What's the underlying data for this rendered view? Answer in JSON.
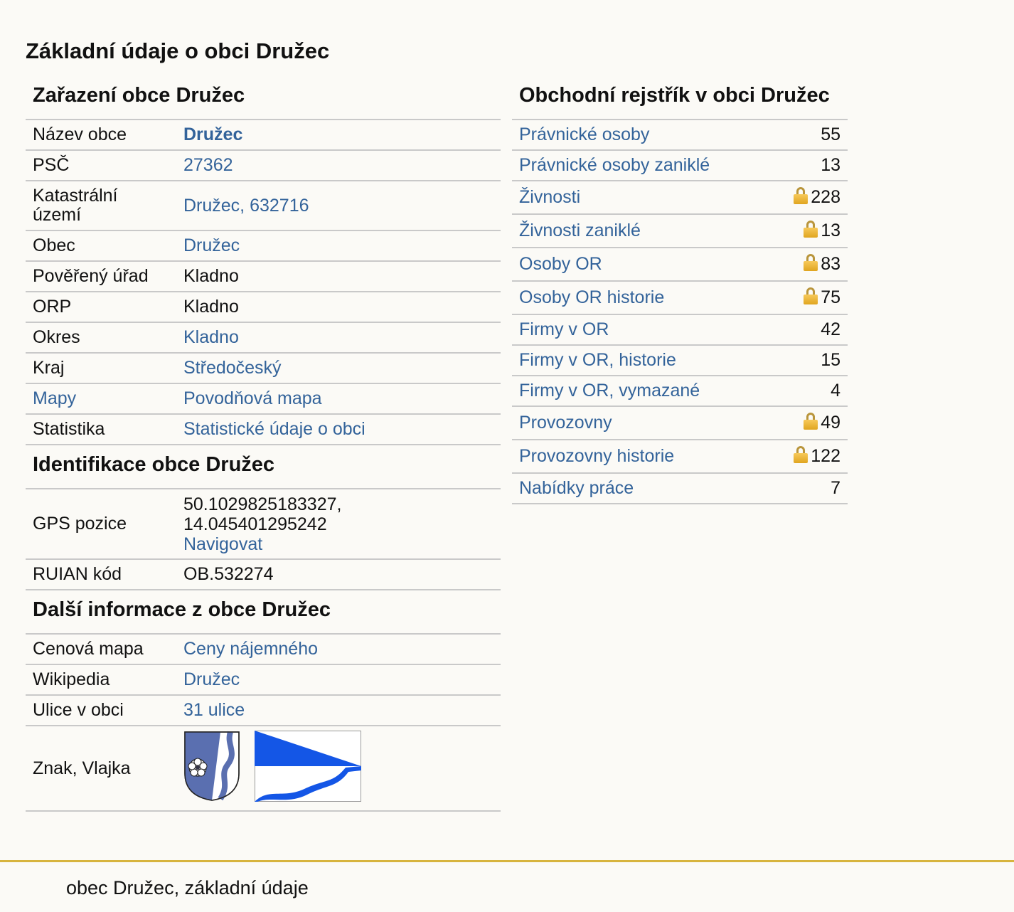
{
  "page": {
    "title": "Základní údaje o obci Družec"
  },
  "zarazeni": {
    "heading": "Zařazení obce Družec",
    "rows": [
      {
        "key": "Název obce",
        "value": "Družec"
      },
      {
        "key": "PSČ",
        "value": "27362"
      },
      {
        "key": "Katastrální území",
        "value": "Družec, 632716"
      },
      {
        "key": "Obec",
        "value": "Družec"
      },
      {
        "key": "Pověřený úřad",
        "value": "Kladno"
      },
      {
        "key": "ORP",
        "value": "Kladno"
      },
      {
        "key": "Okres",
        "value": "Kladno"
      },
      {
        "key": "Kraj",
        "value": "Středočeský"
      },
      {
        "key": "Mapy",
        "value": "Povodňová mapa"
      },
      {
        "key": "Statistika",
        "value": "Statistické údaje o obci"
      }
    ]
  },
  "identifikace": {
    "heading": "Identifikace obce Družec",
    "gps": {
      "key": "GPS pozice",
      "lat": "50.1029825183327,",
      "lon": "14.045401295242",
      "nav": "Navigovat"
    },
    "ruian": {
      "key": "RUIAN kód",
      "value": "OB.532274"
    }
  },
  "dalsi": {
    "heading": "Další informace z obce Družec",
    "rows": [
      {
        "key": "Cenová mapa",
        "value": "Ceny nájemného"
      },
      {
        "key": "Wikipedia",
        "value": "Družec"
      },
      {
        "key": "Ulice v obci",
        "value": "31 ulice"
      }
    ],
    "emblem_key": "Znak, Vlajka",
    "colors": {
      "shield_blue": "#5a6fb0",
      "flag_blue": "#1456e6"
    }
  },
  "rejstrik": {
    "heading": "Obchodní rejstřík v obci Družec",
    "rows": [
      {
        "label": "Právnické osoby",
        "count": "55",
        "locked": false
      },
      {
        "label": "Právnické osoby zaniklé",
        "count": "13",
        "locked": false
      },
      {
        "label": "Živnosti",
        "count": "228",
        "locked": true
      },
      {
        "label": "Živnosti zaniklé",
        "count": "13",
        "locked": true
      },
      {
        "label": "Osoby OR",
        "count": "83",
        "locked": true
      },
      {
        "label": "Osoby OR historie",
        "count": "75",
        "locked": true
      },
      {
        "label": "Firmy v OR",
        "count": "42",
        "locked": false
      },
      {
        "label": "Firmy v OR, historie",
        "count": "15",
        "locked": false
      },
      {
        "label": "Firmy v OR, vymazané",
        "count": "4",
        "locked": false
      },
      {
        "label": "Provozovny",
        "count": "49",
        "locked": true
      },
      {
        "label": "Provozovny historie",
        "count": "122",
        "locked": true
      },
      {
        "label": "Nabídky práce",
        "count": "7",
        "locked": false
      }
    ]
  },
  "footer": {
    "text": "obec Družec, základní údaje"
  }
}
